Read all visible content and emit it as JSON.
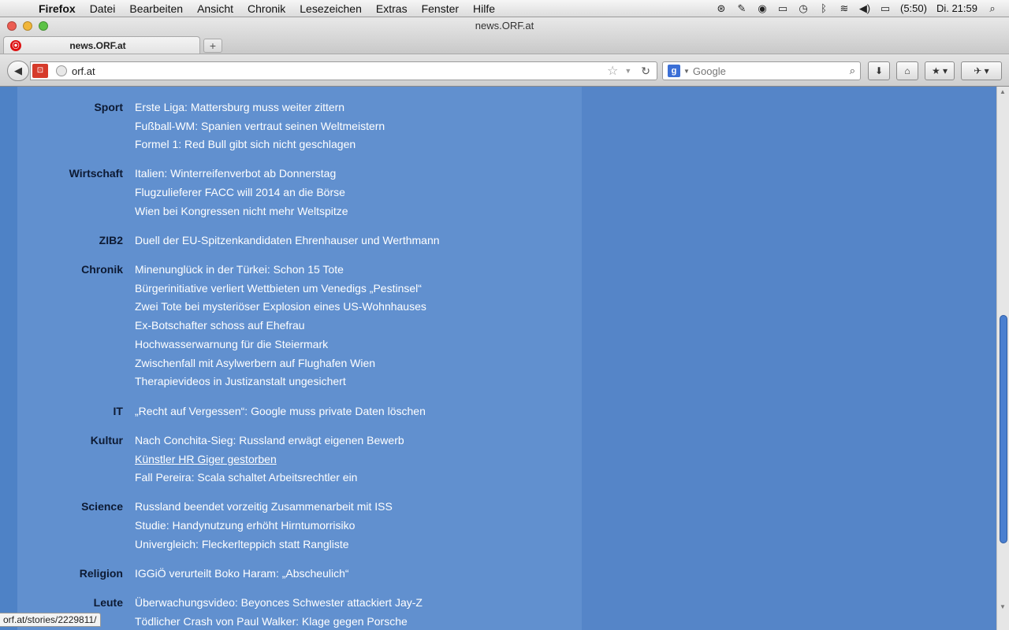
{
  "menubar": {
    "apple": "",
    "app": "Firefox",
    "items": [
      "Datei",
      "Bearbeiten",
      "Ansicht",
      "Chronik",
      "Lesezeichen",
      "Extras",
      "Fenster",
      "Hilfe"
    ],
    "battery": "(5:50)",
    "clock": "Di. 21:59"
  },
  "window": {
    "title": "news.ORF.at"
  },
  "tab": {
    "label": "news.ORF.at",
    "new_tab": "+"
  },
  "toolbar": {
    "url": "orf.at",
    "search_placeholder": "Google"
  },
  "sections": [
    {
      "label": "Sport",
      "headlines": [
        "Erste Liga: Mattersburg muss weiter zittern",
        "Fußball-WM: Spanien vertraut seinen Weltmeistern",
        "Formel 1: Red Bull gibt sich nicht geschlagen"
      ]
    },
    {
      "label": "Wirtschaft",
      "headlines": [
        "Italien: Winterreifenverbot ab Donnerstag",
        "Flugzulieferer FACC will 2014 an die Börse",
        "Wien bei Kongressen nicht mehr Weltspitze"
      ]
    },
    {
      "label": "ZIB2",
      "headlines": [
        "Duell der EU-Spitzenkandidaten Ehrenhauser und Werthmann"
      ]
    },
    {
      "label": "Chronik",
      "headlines": [
        "Minenunglück in der Türkei: Schon 15 Tote",
        "Bürgerinitiative verliert Wettbieten um Venedigs „Pestinsel“",
        "Zwei Tote bei mysteriöser Explosion eines US-Wohnhauses",
        "Ex-Botschafter schoss auf Ehefrau",
        "Hochwasserwarnung für die Steiermark",
        "Zwischenfall mit Asylwerbern auf Flughafen Wien",
        "Therapievideos in Justizanstalt ungesichert"
      ]
    },
    {
      "label": "IT",
      "headlines": [
        "„Recht auf Vergessen“: Google muss private Daten löschen"
      ]
    },
    {
      "label": "Kultur",
      "headlines": [
        "Nach Conchita-Sieg: Russland erwägt eigenen Bewerb",
        "Künstler HR Giger gestorben",
        "Fall Pereira: Scala schaltet Arbeitsrechtler ein"
      ]
    },
    {
      "label": "Science",
      "headlines": [
        "Russland beendet vorzeitig Zusammenarbeit mit ISS",
        "Studie: Handynutzung erhöht Hirntumorrisiko",
        "Univergleich: Fleckerlteppich statt Rangliste"
      ]
    },
    {
      "label": "Religion",
      "headlines": [
        "IGGiÖ verurteilt Boko Haram: „Abscheulich“"
      ]
    },
    {
      "label": "Leute",
      "headlines": [
        "Überwachungsvideo: Beyonces Schwester attackiert Jay-Z",
        "Tödlicher Crash von Paul Walker: Klage gegen Porsche"
      ]
    }
  ],
  "hovered_headline": "Künstler HR Giger gestorben",
  "status": {
    "url": "orf.at/stories/2229811/"
  },
  "colors": {
    "page_bg": "#4e82c6",
    "content_bg": "#6190cf",
    "label_text": "#0d1a33",
    "headline_text": "#ffffff",
    "scroll_thumb": "#4a7fd0"
  }
}
